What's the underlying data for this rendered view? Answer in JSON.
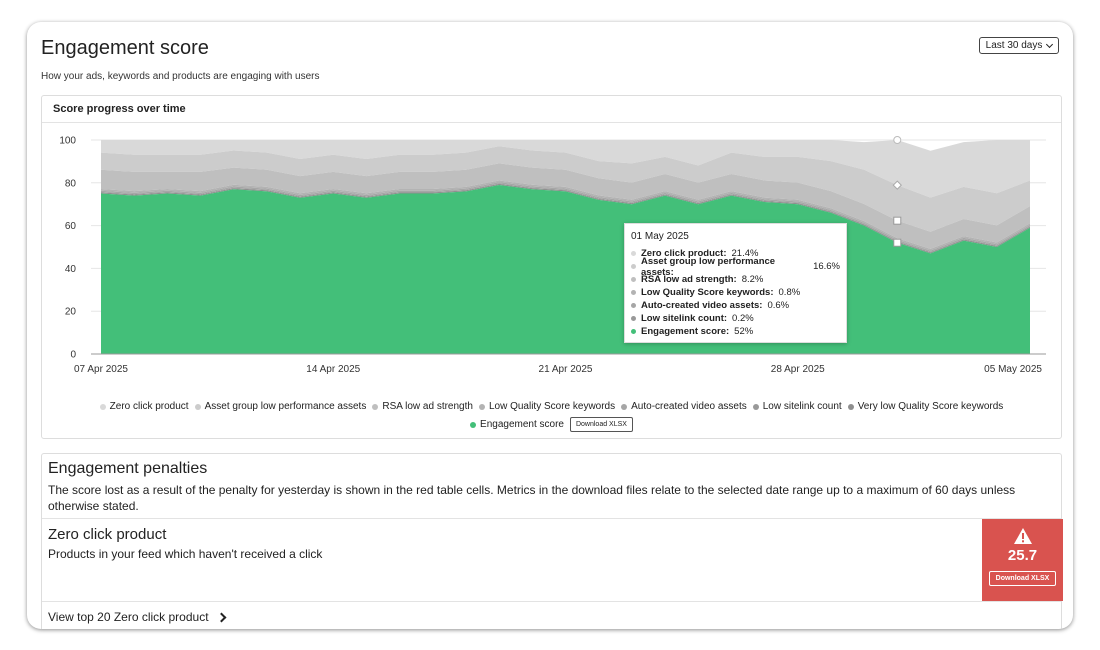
{
  "header": {
    "title": "Engagement score",
    "subtitle": "How your ads, keywords and products are engaging with users",
    "date_range": "Last 30 days"
  },
  "chart_panel": {
    "title": "Score progress over time",
    "download_label": "Download XLSX"
  },
  "chart_data": {
    "type": "area",
    "stacked": true,
    "ylim": [
      0,
      100
    ],
    "yticks": [
      0,
      20,
      40,
      60,
      80,
      100
    ],
    "xticks": [
      "07 Apr 2025",
      "14 Apr 2025",
      "21 Apr 2025",
      "28 Apr 2025",
      "05 May 2025"
    ],
    "x": [
      "07 Apr 2025",
      "08 Apr 2025",
      "09 Apr 2025",
      "10 Apr 2025",
      "11 Apr 2025",
      "12 Apr 2025",
      "13 Apr 2025",
      "14 Apr 2025",
      "15 Apr 2025",
      "16 Apr 2025",
      "17 Apr 2025",
      "18 Apr 2025",
      "19 Apr 2025",
      "20 Apr 2025",
      "21 Apr 2025",
      "22 Apr 2025",
      "23 Apr 2025",
      "24 Apr 2025",
      "25 Apr 2025",
      "26 Apr 2025",
      "27 Apr 2025",
      "28 Apr 2025",
      "29 Apr 2025",
      "30 Apr 2025",
      "01 May 2025",
      "02 May 2025",
      "03 May 2025",
      "04 May 2025",
      "05 May 2025"
    ],
    "series": [
      {
        "name": "Engagement score",
        "color": "#43bf79",
        "values": [
          75,
          74,
          75,
          74,
          77,
          76,
          73,
          75,
          73,
          75,
          75,
          76,
          79,
          77,
          76,
          72,
          70,
          74,
          70,
          74,
          71,
          70,
          66,
          60,
          52,
          47,
          53,
          50,
          59,
          49
        ]
      },
      {
        "name": "Very low Quality Score keywords",
        "color": "#8f8f8f",
        "values": [
          0.5,
          0.5,
          0.5,
          0.5,
          0.5,
          0.5,
          0.5,
          0.5,
          0.5,
          0.5,
          0.5,
          0.5,
          0.5,
          0.5,
          0.5,
          0.5,
          0.5,
          0.5,
          0.5,
          0.5,
          0.5,
          0.5,
          0.5,
          0.5,
          0.5,
          0.5,
          0.5,
          0.5,
          0.5,
          0.5
        ]
      },
      {
        "name": "Low sitelink count",
        "color": "#999999",
        "values": [
          0.2,
          0.2,
          0.2,
          0.2,
          0.2,
          0.2,
          0.2,
          0.2,
          0.2,
          0.2,
          0.2,
          0.2,
          0.2,
          0.2,
          0.2,
          0.2,
          0.2,
          0.2,
          0.2,
          0.2,
          0.2,
          0.2,
          0.2,
          0.2,
          0.2,
          0.2,
          0.2,
          0.2,
          0.2,
          0.2
        ]
      },
      {
        "name": "Auto-created video assets",
        "color": "#a6a6a6",
        "values": [
          0.6,
          0.6,
          0.6,
          0.6,
          0.6,
          0.6,
          0.6,
          0.6,
          0.6,
          0.6,
          0.6,
          0.6,
          0.6,
          0.6,
          0.6,
          0.6,
          0.6,
          0.6,
          0.6,
          0.6,
          0.6,
          0.6,
          0.6,
          0.6,
          0.6,
          0.6,
          0.6,
          0.6,
          0.6,
          0.6
        ]
      },
      {
        "name": "Low Quality Score keywords",
        "color": "#b3b3b3",
        "values": [
          0.8,
          0.8,
          0.8,
          0.8,
          0.8,
          0.8,
          0.8,
          0.8,
          0.8,
          0.8,
          0.8,
          0.8,
          0.8,
          0.8,
          0.8,
          0.8,
          0.8,
          0.8,
          0.8,
          0.8,
          0.8,
          0.8,
          0.8,
          0.8,
          0.8,
          0.8,
          0.8,
          0.8,
          0.8,
          0.8
        ]
      },
      {
        "name": "RSA low ad strength",
        "color": "#bfbfbf",
        "values": [
          9,
          9,
          8,
          9,
          8,
          8,
          8,
          8,
          8,
          8,
          8,
          8,
          8,
          8,
          8,
          8,
          8,
          8,
          8,
          8,
          8,
          8,
          8,
          8,
          8.2,
          8,
          8,
          8,
          8,
          8
        ]
      },
      {
        "name": "Asset group low performance assets",
        "color": "#cccccc",
        "values": [
          8,
          8,
          8,
          8,
          8,
          8,
          8,
          8,
          8,
          8,
          8,
          8,
          8,
          8,
          8,
          8,
          9,
          8,
          8,
          10,
          11,
          12,
          14,
          16,
          16.6,
          16,
          15,
          15,
          12,
          16
        ]
      },
      {
        "name": "Zero click product",
        "color": "#d9d9d9",
        "values": [
          6.9,
          7.9,
          7.9,
          6.9,
          5.9,
          6.9,
          9.9,
          7.9,
          9.9,
          7.9,
          7.9,
          6.9,
          3.9,
          5.9,
          6.9,
          10.9,
          12.9,
          9.9,
          13.9,
          9.9,
          10.9,
          11.9,
          13.9,
          12.9,
          21.4,
          21.9,
          20.9,
          24.9,
          19.9,
          24.9
        ]
      }
    ]
  },
  "legend": {
    "items": [
      {
        "label": "Zero click product",
        "color": "#d9d9d9"
      },
      {
        "label": "Asset group low performance assets",
        "color": "#cccccc"
      },
      {
        "label": "RSA low ad strength",
        "color": "#bfbfbf"
      },
      {
        "label": "Low Quality Score keywords",
        "color": "#b3b3b3"
      },
      {
        "label": "Auto-created video assets",
        "color": "#a6a6a6"
      },
      {
        "label": "Low sitelink count",
        "color": "#999999"
      },
      {
        "label": "Very low Quality Score keywords",
        "color": "#8f8f8f"
      }
    ],
    "engagement": {
      "label": "Engagement score",
      "color": "#43bf79"
    }
  },
  "tooltip": {
    "date": "01 May 2025",
    "rows": [
      {
        "label": "Zero click product",
        "value": "21.4%",
        "color": "#d9d9d9"
      },
      {
        "label": "Asset group low performance assets",
        "value": "16.6%",
        "color": "#cccccc"
      },
      {
        "label": "RSA low ad strength",
        "value": "8.2%",
        "color": "#bfbfbf"
      },
      {
        "label": "Low Quality Score keywords",
        "value": "0.8%",
        "color": "#b3b3b3"
      },
      {
        "label": "Auto-created video assets",
        "value": "0.6%",
        "color": "#a6a6a6"
      },
      {
        "label": "Low sitelink count",
        "value": "0.2%",
        "color": "#999999"
      },
      {
        "label": "Engagement score",
        "value": "52%",
        "color": "#43bf79"
      }
    ]
  },
  "penalties": {
    "title": "Engagement penalties",
    "description": "The score lost as a result of the penalty for yesterday is shown in the red table cells. Metrics in the download files relate to the selected date range up to a maximum of 60 days unless otherwise stated.",
    "item": {
      "title": "Zero click product",
      "description": "Products in your feed which haven't received a click",
      "score": "25.7",
      "download_label": "Download XLSX",
      "view_link": "View top 20 Zero click product"
    }
  }
}
